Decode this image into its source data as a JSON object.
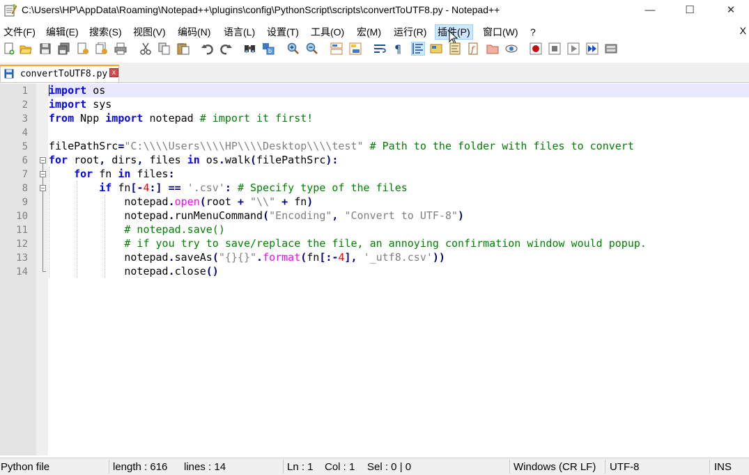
{
  "window": {
    "title": "C:\\Users\\HP\\AppData\\Roaming\\Notepad++\\plugins\\config\\PythonScript\\scripts\\convertToUTF8.py - Notepad++",
    "minimize": "—",
    "maximize": "☐",
    "close": "✕"
  },
  "menu": {
    "items": [
      "文件(F)",
      "编辑(E)",
      "搜索(S)",
      "视图(V)",
      "编码(N)",
      "语言(L)",
      "设置(T)",
      "工具(O)",
      "宏(M)",
      "运行(R)",
      "插件(P)",
      "窗口(W)",
      "?"
    ],
    "hovered": "插件(P)",
    "close_doc": "X"
  },
  "tab": {
    "label": "convertToUTF8.py",
    "close": "x"
  },
  "editor": {
    "line_numbers": [
      "1",
      "2",
      "3",
      "4",
      "5",
      "6",
      "7",
      "8",
      "9",
      "10",
      "11",
      "12",
      "13",
      "14"
    ],
    "current_line": 1
  },
  "status": {
    "language": "Python file",
    "length": "length : 616",
    "lines": "lines : 14",
    "ln": "Ln : 1",
    "col": "Col : 1",
    "sel": "Sel : 0 | 0",
    "eol": "Windows (CR LF)",
    "encoding": "UTF-8",
    "mode": "INS"
  },
  "colors": {
    "keyword": "#0000ff",
    "string": "#808080",
    "comment": "#008000",
    "operator": "#000080",
    "number": "#ff0000",
    "builtin": "#ff00ff",
    "tab_accent": "#f9a521",
    "current_line": "#e8e8ff"
  },
  "toolbar_icons": [
    "new-file-icon",
    "open-file-icon",
    "save-icon",
    "save-all-icon",
    "close-icon",
    "close-all-icon",
    "print-icon",
    "cut-icon",
    "copy-icon",
    "paste-icon",
    "undo-icon",
    "redo-icon",
    "find-icon",
    "replace-icon",
    "zoom-in-icon",
    "zoom-out-icon",
    "sync-vertical-icon",
    "sync-horizontal-icon",
    "word-wrap-icon",
    "show-all-chars-icon",
    "indent-guide-icon",
    "user-lang-icon",
    "doc-map-icon",
    "function-list-icon",
    "folder-workspace-icon",
    "monitor-icon",
    "record-macro-icon",
    "stop-record-icon",
    "play-macro-icon",
    "run-macro-multiple-icon",
    "save-macro-icon"
  ]
}
